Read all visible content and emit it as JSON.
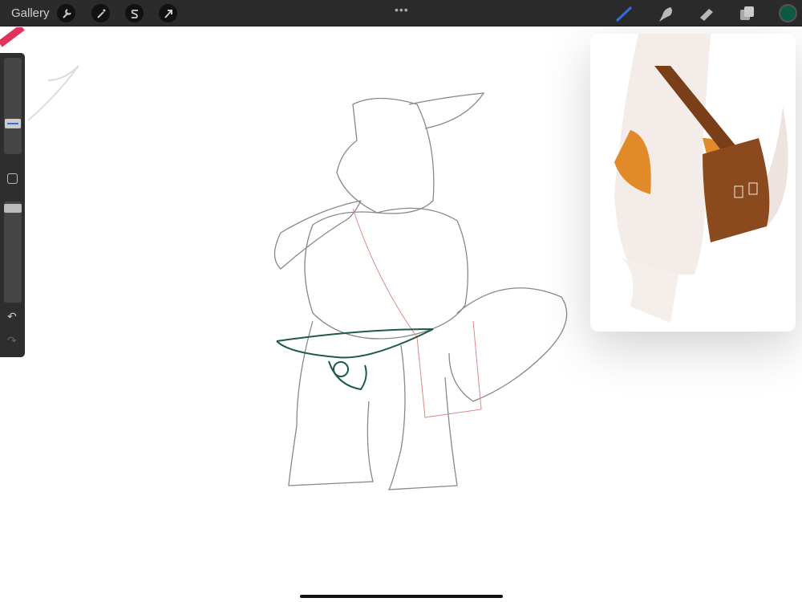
{
  "toolbar": {
    "gallery_label": "Gallery",
    "more_label": "•••"
  },
  "icons": {
    "left": [
      "wrench-icon",
      "magic-wand-icon",
      "selection-icon",
      "transform-arrow-icon"
    ],
    "right": [
      "brush-icon",
      "smudge-icon",
      "eraser-icon",
      "layers-icon"
    ]
  },
  "colors": {
    "active_color": "#0e5a45",
    "brush_active": "#2f6fe0"
  },
  "sidebar": {
    "undo": "↶",
    "redo": "↷"
  }
}
